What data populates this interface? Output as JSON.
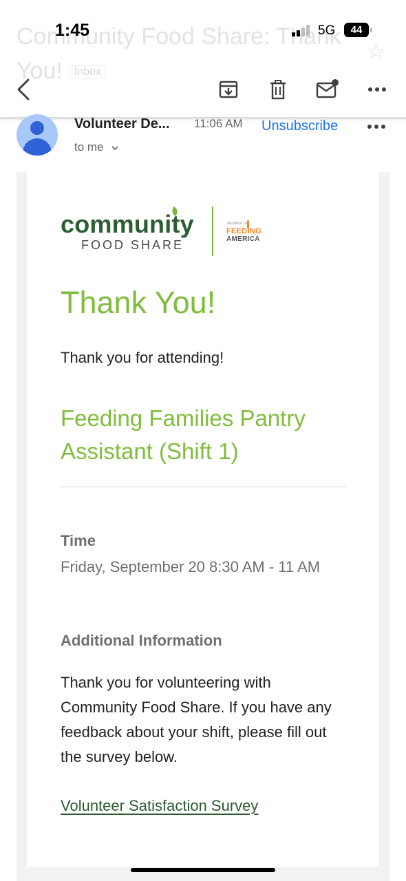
{
  "status_bar": {
    "time": "1:45",
    "network": "5G",
    "battery": "44"
  },
  "background_subject": {
    "text": "Community Food Share: Thank You!",
    "label": "Inbox"
  },
  "toolbar": {
    "back_icon": "chevron-left-icon",
    "archive_icon": "archive-icon",
    "delete_icon": "trash-icon",
    "unread_icon": "mark-unread-icon",
    "more_icon": "more-horizontal-icon"
  },
  "message_header": {
    "sender": "Volunteer De...",
    "time": "11:06 AM",
    "unsubscribe": "Unsubscribe",
    "recipient": "to me"
  },
  "logo": {
    "name": "community",
    "subtitle": "FOOD SHARE",
    "partner_prefix": "MEMBER OF",
    "partner_top": "FEEDING",
    "partner_bottom": "AMERICA"
  },
  "email": {
    "heading": "Thank You!",
    "intro": "Thank you for attending!",
    "shift_title": "Feeding Families Pantry Assistant (Shift 1)",
    "time_label": "Time",
    "time_value": "Friday, September 20 8:30 AM - 11 AM",
    "info_label": "Additional Information",
    "info_body": "Thank you for volunteering with Community Food Share. If you have any feedback about your shift, please fill out the survey below.",
    "survey_link": "Volunteer Satisfaction Survey"
  },
  "colors": {
    "brand_green": "#80bd3c",
    "logo_green": "#2b5e33",
    "link_blue": "#1a73e8",
    "feeding_orange": "#f08a24"
  }
}
